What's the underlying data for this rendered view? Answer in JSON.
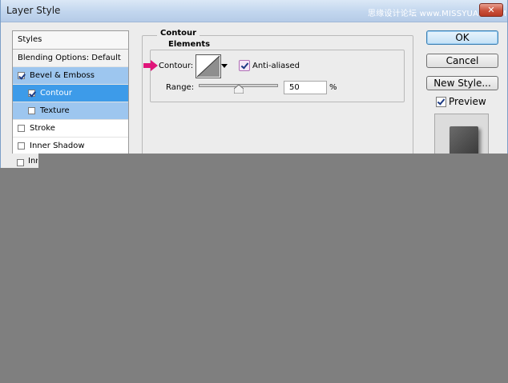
{
  "window": {
    "title": "Layer Style",
    "watermark": "思缘设计论坛 www.MISSYUAN.COM"
  },
  "styles_panel": {
    "header": "Styles",
    "blending_options": "Blending Options: Default",
    "items": [
      {
        "label": "Bevel & Emboss",
        "checked": true
      },
      {
        "label": "Contour",
        "checked": true
      },
      {
        "label": "Texture",
        "checked": false
      },
      {
        "label": "Stroke",
        "checked": false
      },
      {
        "label": "Inner Shadow",
        "checked": false
      },
      {
        "label": "Inner Glow",
        "checked": false
      }
    ]
  },
  "contour_section": {
    "title": "Contour",
    "elements_title": "Elements",
    "contour_label": "Contour:",
    "anti_aliased_label": "Anti-aliased",
    "anti_aliased_checked": true,
    "range_label": "Range:",
    "range_value": "50",
    "range_unit": "%",
    "range_fraction": 0.5
  },
  "buttons": {
    "ok": "OK",
    "cancel": "Cancel",
    "new_style": "New Style..."
  },
  "preview": {
    "label": "Preview",
    "checked": true
  },
  "colors": {
    "selection_dark": "#3d9be9",
    "selection_light": "#9dc6ef",
    "arrow": "#e0157a"
  }
}
